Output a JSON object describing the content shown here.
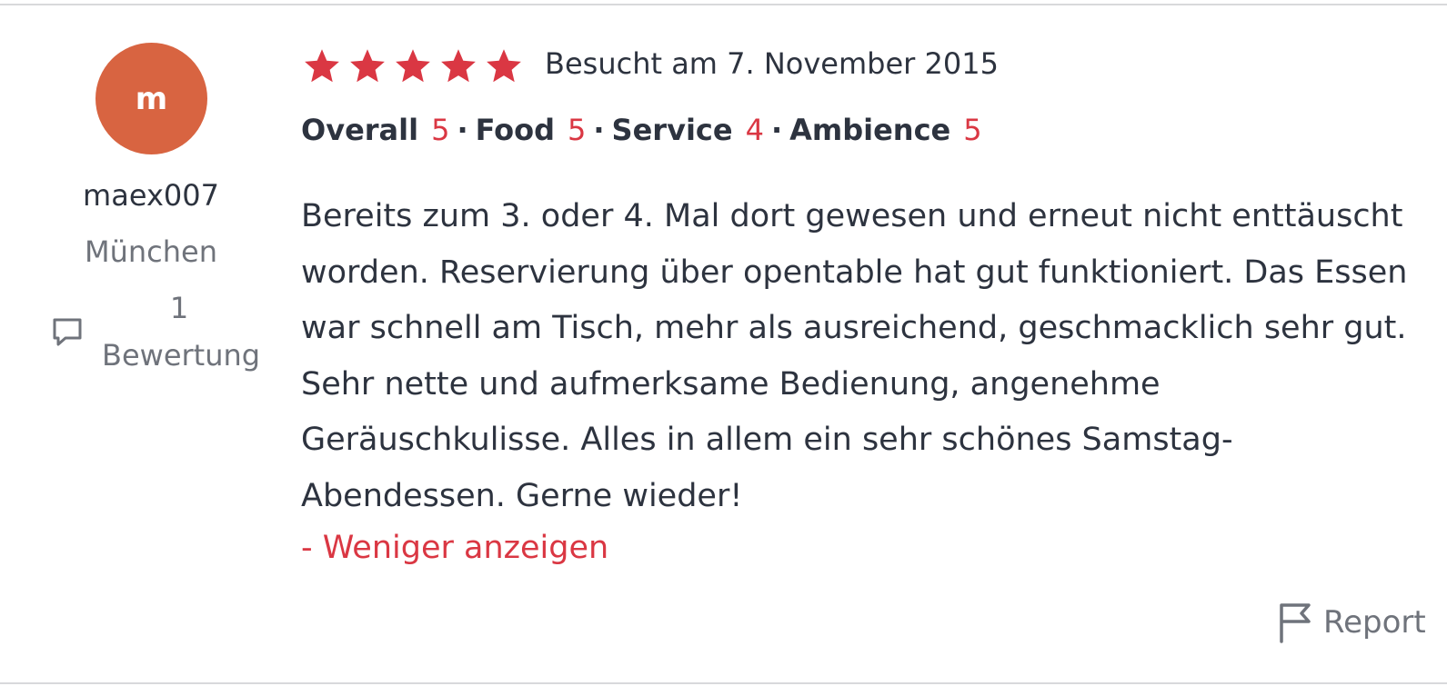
{
  "reviewer": {
    "avatar_initial": "m",
    "avatar_color": "#d86441",
    "username": "maex007",
    "location": "München",
    "review_count": "1",
    "review_count_label": "Bewertung",
    "review_count_icon": "comment-icon"
  },
  "review": {
    "star_rating": 5,
    "star_max": 5,
    "star_color": "#da3743",
    "visit_date": "Besucht am 7. November 2015",
    "ratings": [
      {
        "label": "Overall",
        "value": "5"
      },
      {
        "label": "Food",
        "value": "5"
      },
      {
        "label": "Service",
        "value": "4"
      },
      {
        "label": "Ambience",
        "value": "5"
      }
    ],
    "separator": "·",
    "text_lines": [
      "Bereits zum 3. oder 4. Mal dort gewesen und erneut nicht enttäuscht",
      "worden. Reservierung über opentable hat gut funktioniert. Das Essen",
      "war schnell am Tisch, mehr als ausreichend, geschmacklich sehr gut.",
      "Sehr nette und aufmerksame Bedienung, angenehme",
      "Geräuschkulisse. Alles in allem ein sehr schönes Samstag-",
      "Abendessen. Gerne wieder!"
    ],
    "show_less_label": "- Weniger anzeigen",
    "report_label": "Report",
    "report_icon": "flag-icon"
  }
}
